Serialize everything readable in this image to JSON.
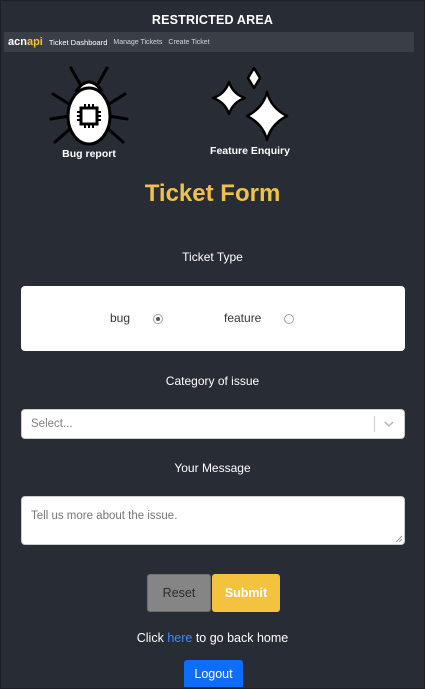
{
  "header": {
    "title": "RESTRICTED AREA"
  },
  "navbar": {
    "brand_acn": "acn",
    "brand_api": "api",
    "items": [
      "Ticket Dashboard",
      "Manage Tickets",
      "Create Ticket"
    ]
  },
  "cards": {
    "bug": {
      "label": "Bug report",
      "icon": "bug-icon"
    },
    "feature": {
      "label": "Feature Enquiry",
      "icon": "sparkles-icon"
    }
  },
  "form": {
    "title": "Ticket Form",
    "ticket_type_label": "Ticket Type",
    "options": [
      {
        "label": "bug",
        "checked": true
      },
      {
        "label": "feature",
        "checked": false
      }
    ],
    "category_label": "Category of issue",
    "category_placeholder": "Select...",
    "message_label": "Your Message",
    "message_placeholder": "Tell us more about the issue.",
    "reset_label": "Reset",
    "submit_label": "Submit"
  },
  "footer": {
    "prefix": "Click ",
    "link": "here",
    "suffix": " to go back home",
    "logout_label": "Logout"
  },
  "colors": {
    "background": "#282c34",
    "accent": "#f0c04a",
    "submit": "#f3c23f",
    "logout": "#0d6efd",
    "link": "#3d8bfd"
  }
}
